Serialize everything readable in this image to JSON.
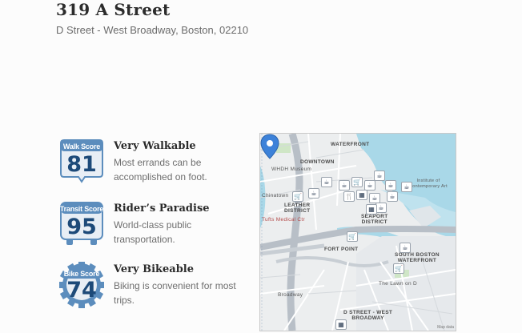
{
  "header": {
    "title": "319 A Street",
    "address_prefix": "D Street - West Broadway, Boston",
    "zip": "02210"
  },
  "scores": [
    {
      "badge_label": "Walk Score",
      "value": "81",
      "heading": "Very Walkable",
      "description": "Most errands can be accomplished on foot.",
      "icon": "walk-score-badge"
    },
    {
      "badge_label": "Transit Score",
      "value": "95",
      "heading": "Rider’s Paradise",
      "description": "World-class public transportation.",
      "icon": "transit-score-badge"
    },
    {
      "badge_label": "Bike Score",
      "value": "74",
      "heading": "Very Bikeable",
      "description": "Biking is convenient for most trips.",
      "icon": "bike-score-badge"
    }
  ],
  "map": {
    "labels": {
      "waterfront_top": "WATERFRONT",
      "downtown": "DOWNTOWN",
      "museum": "WHDH Museum",
      "chinatown": "Chinatown",
      "leather_district": "LEATHER\nDISTRICT",
      "tufts": "Tufts Medical Ctr",
      "fort_point": "FORT POINT",
      "seaport": "SEAPORT\nDISTRICT",
      "south_boston_waterfront": "SOUTH BOSTON\nWATERFRONT",
      "d_street": "D STREET - WEST\nBROADWAY",
      "broadway": "Broadway",
      "the_lawn": "The Lawn on D",
      "contemporary_art": "Institute of\nContemporary Art",
      "attribution": "Map data"
    },
    "colors": {
      "water": "#a9d8e8",
      "land": "#eceeef",
      "highway": "#b8bfc7",
      "pin": "#3d82d9"
    }
  }
}
